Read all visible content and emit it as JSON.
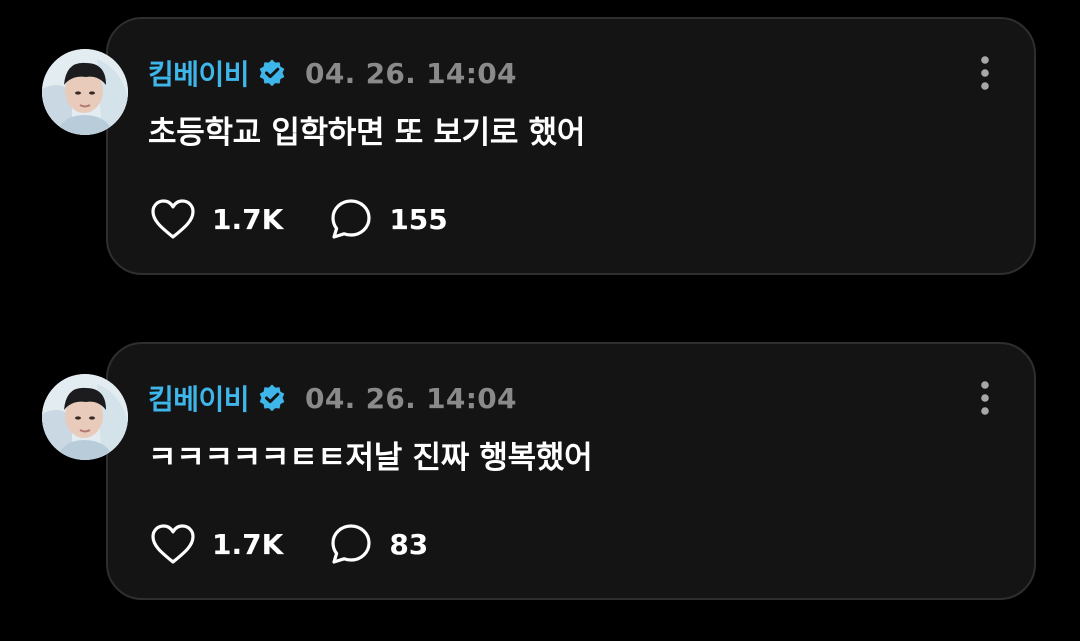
{
  "colors": {
    "background": "#000000",
    "card": "#141414",
    "card_border": "#2e2e2e",
    "username": "#3fb6ea",
    "timestamp": "#8a8a8a",
    "text": "#ffffff"
  },
  "posts": [
    {
      "username": "킴베이비",
      "verified_icon": "verified-badge-icon",
      "timestamp": "04. 26. 14:04",
      "text": "초등학교 입학하면 또 보기로 했어",
      "likes": "1.7K",
      "comments": "155"
    },
    {
      "username": "킴베이비",
      "verified_icon": "verified-badge-icon",
      "timestamp": "04. 26. 14:04",
      "text": "ㅋㅋㅋㅋㅋㅌㅌ저날 진짜 행복했어",
      "likes": "1.7K",
      "comments": "83"
    }
  ]
}
